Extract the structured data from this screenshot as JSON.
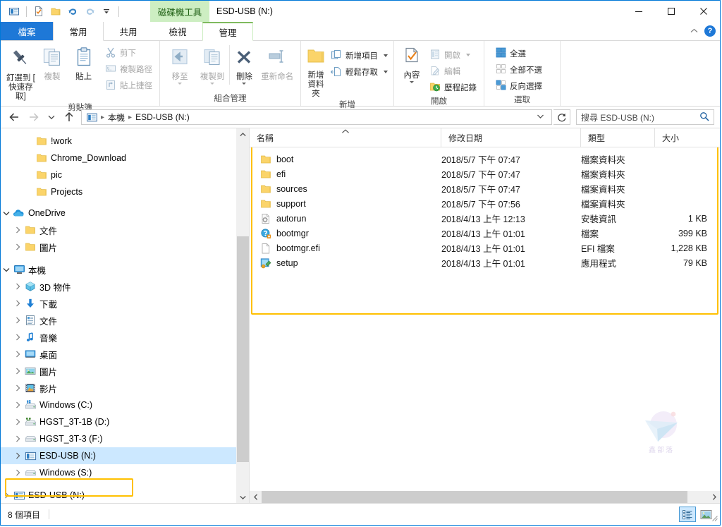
{
  "window": {
    "title": "ESD-USB (N:)",
    "contextual_tab_title": "磁碟機工具",
    "minimize_icon": "minimize-icon",
    "maximize_icon": "maximize-icon",
    "close_icon": "close-icon"
  },
  "quick_access": {
    "items": [
      {
        "name": "explorer-properties-icon",
        "label": ""
      },
      {
        "name": "properties-icon",
        "label": ""
      },
      {
        "name": "new-folder-icon",
        "label": ""
      },
      {
        "name": "undo-icon",
        "label": ""
      },
      {
        "name": "redo-icon",
        "label": ""
      },
      {
        "name": "customize-qat-icon",
        "label": ""
      }
    ]
  },
  "tabs": [
    {
      "label": "檔案",
      "kind": "file"
    },
    {
      "label": "常用",
      "kind": "active"
    },
    {
      "label": "共用",
      "kind": "normal"
    },
    {
      "label": "檢視",
      "kind": "normal"
    },
    {
      "label": "管理",
      "kind": "contextual"
    }
  ],
  "tab_right": {
    "collapse_label": "^",
    "help_label": "?"
  },
  "ribbon": {
    "groups": [
      {
        "label": "剪貼簿",
        "big_buttons": [
          {
            "label": "釘選到 [ 快速存取]",
            "line1": "釘選到 [",
            "line2": "快速存取]",
            "icon": "pin-icon",
            "dim": false
          },
          {
            "label": "複製",
            "icon": "copy-icon",
            "dim": true
          },
          {
            "label": "貼上",
            "icon": "paste-icon",
            "dim": false
          }
        ],
        "small_buttons": [
          {
            "label": "剪下",
            "icon": "cut-icon",
            "dim": true
          },
          {
            "label": "複製路徑",
            "icon": "copy-path-icon",
            "dim": true
          },
          {
            "label": "貼上捷徑",
            "icon": "paste-shortcut-icon",
            "dim": true
          }
        ]
      },
      {
        "label": "組合管理",
        "big_buttons": [
          {
            "label": "移至",
            "icon": "move-to-icon",
            "dim": true,
            "caret": true
          },
          {
            "label": "複製到",
            "icon": "copy-to-icon",
            "dim": true,
            "caret": true
          },
          {
            "label": "刪除",
            "icon": "delete-icon",
            "dim": false,
            "caret": true
          },
          {
            "label": "重新命名",
            "icon": "rename-icon",
            "dim": true
          }
        ],
        "small_buttons": []
      },
      {
        "label": "新增",
        "big_buttons": [
          {
            "label": "新增 資料夾",
            "line1": "新增",
            "line2": "資料夾",
            "icon": "new-folder-icon",
            "dim": false
          }
        ],
        "small_buttons": [
          {
            "label": "新增項目",
            "icon": "new-item-icon",
            "dim": false,
            "caret": true
          },
          {
            "label": "輕鬆存取",
            "icon": "easy-access-icon",
            "dim": false,
            "caret": true
          }
        ]
      },
      {
        "label": "開啟",
        "big_buttons": [
          {
            "label": "內容",
            "icon": "properties-icon",
            "dim": false,
            "caret": true
          }
        ],
        "small_buttons": [
          {
            "label": "開啟",
            "icon": "open-icon",
            "dim": true,
            "caret": true
          },
          {
            "label": "編輯",
            "icon": "edit-icon",
            "dim": true
          },
          {
            "label": "歷程記錄",
            "icon": "history-icon",
            "dim": false
          }
        ]
      },
      {
        "label": "選取",
        "big_buttons": [],
        "small_buttons": [
          {
            "label": "全選",
            "icon": "select-all-icon",
            "dim": false
          },
          {
            "label": "全部不選",
            "icon": "select-none-icon",
            "dim": false
          },
          {
            "label": "反向選擇",
            "icon": "invert-selection-icon",
            "dim": false
          }
        ]
      }
    ]
  },
  "address_bar": {
    "back_icon": "back-arrow-icon",
    "forward_icon": "forward-arrow-icon",
    "recent_icon": "recent-locations-icon",
    "up_icon": "up-arrow-icon",
    "drive_icon": "drive-icon",
    "breadcrumbs": [
      "本機",
      "ESD-USB (N:)"
    ],
    "refresh_icon": "refresh-icon",
    "dropdown_icon": "chevron-down-icon",
    "search_placeholder": "搜尋 ESD-USB (N:)",
    "search_value": "",
    "search_icon": "search-icon"
  },
  "nav_tree": {
    "items": [
      {
        "label": "!work",
        "icon": "folder-icon",
        "indent": 2,
        "twist": "none",
        "selected": false
      },
      {
        "label": "Chrome_Download",
        "icon": "folder-icon",
        "indent": 2,
        "twist": "none",
        "selected": false
      },
      {
        "label": "pic",
        "icon": "folder-icon",
        "indent": 2,
        "twist": "none",
        "selected": false
      },
      {
        "label": "Projects",
        "icon": "folder-icon",
        "indent": 2,
        "twist": "none",
        "selected": false
      },
      {
        "label": "OneDrive",
        "icon": "onedrive-icon",
        "indent": 0,
        "twist": "open",
        "selected": false
      },
      {
        "label": "文件",
        "icon": "folder-icon",
        "indent": 1,
        "twist": "closed",
        "selected": false
      },
      {
        "label": "圖片",
        "icon": "folder-icon",
        "indent": 1,
        "twist": "closed",
        "selected": false
      },
      {
        "label": "本機",
        "icon": "this-pc-icon",
        "indent": 0,
        "twist": "open",
        "selected": false
      },
      {
        "label": "3D 物件",
        "icon": "3d-objects-icon",
        "indent": 1,
        "twist": "closed",
        "selected": false
      },
      {
        "label": "下載",
        "icon": "downloads-icon",
        "indent": 1,
        "twist": "closed",
        "selected": false
      },
      {
        "label": "文件",
        "icon": "documents-icon",
        "indent": 1,
        "twist": "closed",
        "selected": false
      },
      {
        "label": "音樂",
        "icon": "music-icon",
        "indent": 1,
        "twist": "closed",
        "selected": false
      },
      {
        "label": "桌面",
        "icon": "desktop-icon",
        "indent": 1,
        "twist": "closed",
        "selected": false
      },
      {
        "label": "圖片",
        "icon": "pictures-icon",
        "indent": 1,
        "twist": "closed",
        "selected": false
      },
      {
        "label": "影片",
        "icon": "videos-icon",
        "indent": 1,
        "twist": "closed",
        "selected": false
      },
      {
        "label": "Windows (C:)",
        "icon": "system-drive-icon",
        "indent": 1,
        "twist": "closed",
        "selected": false
      },
      {
        "label": "HGST_3T-1B (D:)",
        "icon": "network-drive-icon",
        "indent": 1,
        "twist": "closed",
        "selected": false
      },
      {
        "label": "HGST_3T-3 (F:)",
        "icon": "hard-drive-icon",
        "indent": 1,
        "twist": "closed",
        "selected": false
      },
      {
        "label": "ESD-USB (N:)",
        "icon": "usb-drive-icon",
        "indent": 1,
        "twist": "closed",
        "selected": true
      },
      {
        "label": "Windows (S:)",
        "icon": "hard-drive-icon",
        "indent": 1,
        "twist": "closed",
        "selected": false
      },
      {
        "label": "ESD-USB (N:)",
        "icon": "usb-drive-icon",
        "indent": 0,
        "twist": "closed",
        "selected": false
      }
    ]
  },
  "file_list": {
    "columns": [
      {
        "label": "名稱",
        "sorted": true,
        "sort_dir": "asc"
      },
      {
        "label": "修改日期",
        "sorted": false
      },
      {
        "label": "類型",
        "sorted": false
      },
      {
        "label": "大小",
        "sorted": false
      }
    ],
    "rows": [
      {
        "name": "boot",
        "date": "2018/5/7 下午 07:47",
        "type": "檔案資料夾",
        "size": "",
        "icon": "folder-icon"
      },
      {
        "name": "efi",
        "date": "2018/5/7 下午 07:47",
        "type": "檔案資料夾",
        "size": "",
        "icon": "folder-icon"
      },
      {
        "name": "sources",
        "date": "2018/5/7 下午 07:47",
        "type": "檔案資料夾",
        "size": "",
        "icon": "folder-icon"
      },
      {
        "name": "support",
        "date": "2018/5/7 下午 07:56",
        "type": "檔案資料夾",
        "size": "",
        "icon": "folder-icon"
      },
      {
        "name": "autorun",
        "date": "2018/4/13 上午 12:13",
        "type": "安裝資訊",
        "size": "1 KB",
        "icon": "setup-information-icon"
      },
      {
        "name": "bootmgr",
        "date": "2018/4/13 上午 01:01",
        "type": "檔案",
        "size": "399 KB",
        "icon": "unknown-file-icon"
      },
      {
        "name": "bootmgr.efi",
        "date": "2018/4/13 上午 01:01",
        "type": "EFI 檔案",
        "size": "1,228 KB",
        "icon": "blank-file-icon"
      },
      {
        "name": "setup",
        "date": "2018/4/13 上午 01:01",
        "type": "應用程式",
        "size": "79 KB",
        "icon": "application-icon"
      }
    ]
  },
  "watermark": {
    "text": "鑫部落"
  },
  "status_bar": {
    "item_count": "8 個項目",
    "details_view_icon": "details-view-icon",
    "large-icons_view_icon": "large-icons-view-icon"
  },
  "colors": {
    "accent": "#1e78d7",
    "highlight_box": "#ffc000",
    "selection": "#cce8ff",
    "contextual_green": "#cdeec2"
  }
}
